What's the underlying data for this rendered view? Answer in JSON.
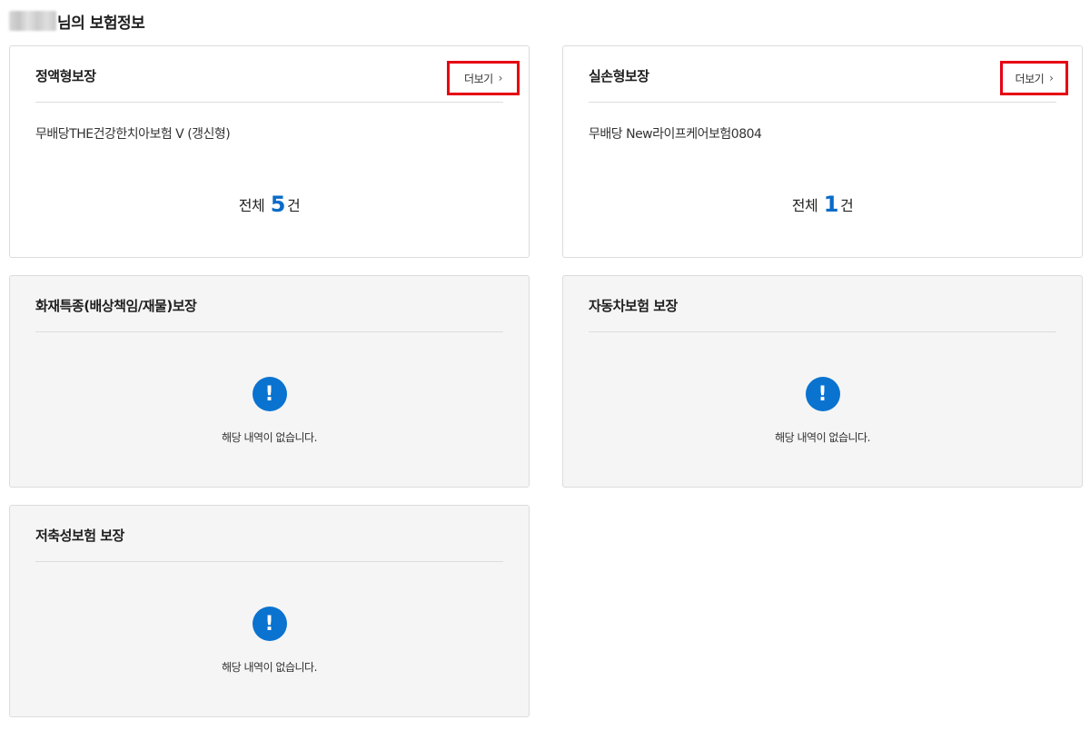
{
  "header": {
    "title": "님의 보험정보"
  },
  "cards": {
    "fixed": {
      "title": "정액형보장",
      "more_label": "더보기",
      "policy": "무배당THE건강한치아보험 V (갱신형)",
      "total_prefix": "전체",
      "total_count": "5",
      "total_suffix": "건"
    },
    "indemnity": {
      "title": "실손형보장",
      "more_label": "더보기",
      "policy": "무배당 New라이프케어보험0804",
      "total_prefix": "전체",
      "total_count": "1",
      "total_suffix": "건"
    },
    "fire": {
      "title": "화재특종(배상책임/재물)보장",
      "empty_text": "해당 내역이 없습니다."
    },
    "auto": {
      "title": "자동차보험 보장",
      "empty_text": "해당 내역이 없습니다."
    },
    "savings": {
      "title": "저축성보험 보장",
      "empty_text": "해당 내역이 없습니다."
    }
  },
  "icons": {
    "more": "chevron-right-icon",
    "empty": "exclamation-circle-icon"
  },
  "colors": {
    "accent": "#0a73d0",
    "highlight_border": "#e60012",
    "empty_card_bg": "#f5f5f5"
  }
}
